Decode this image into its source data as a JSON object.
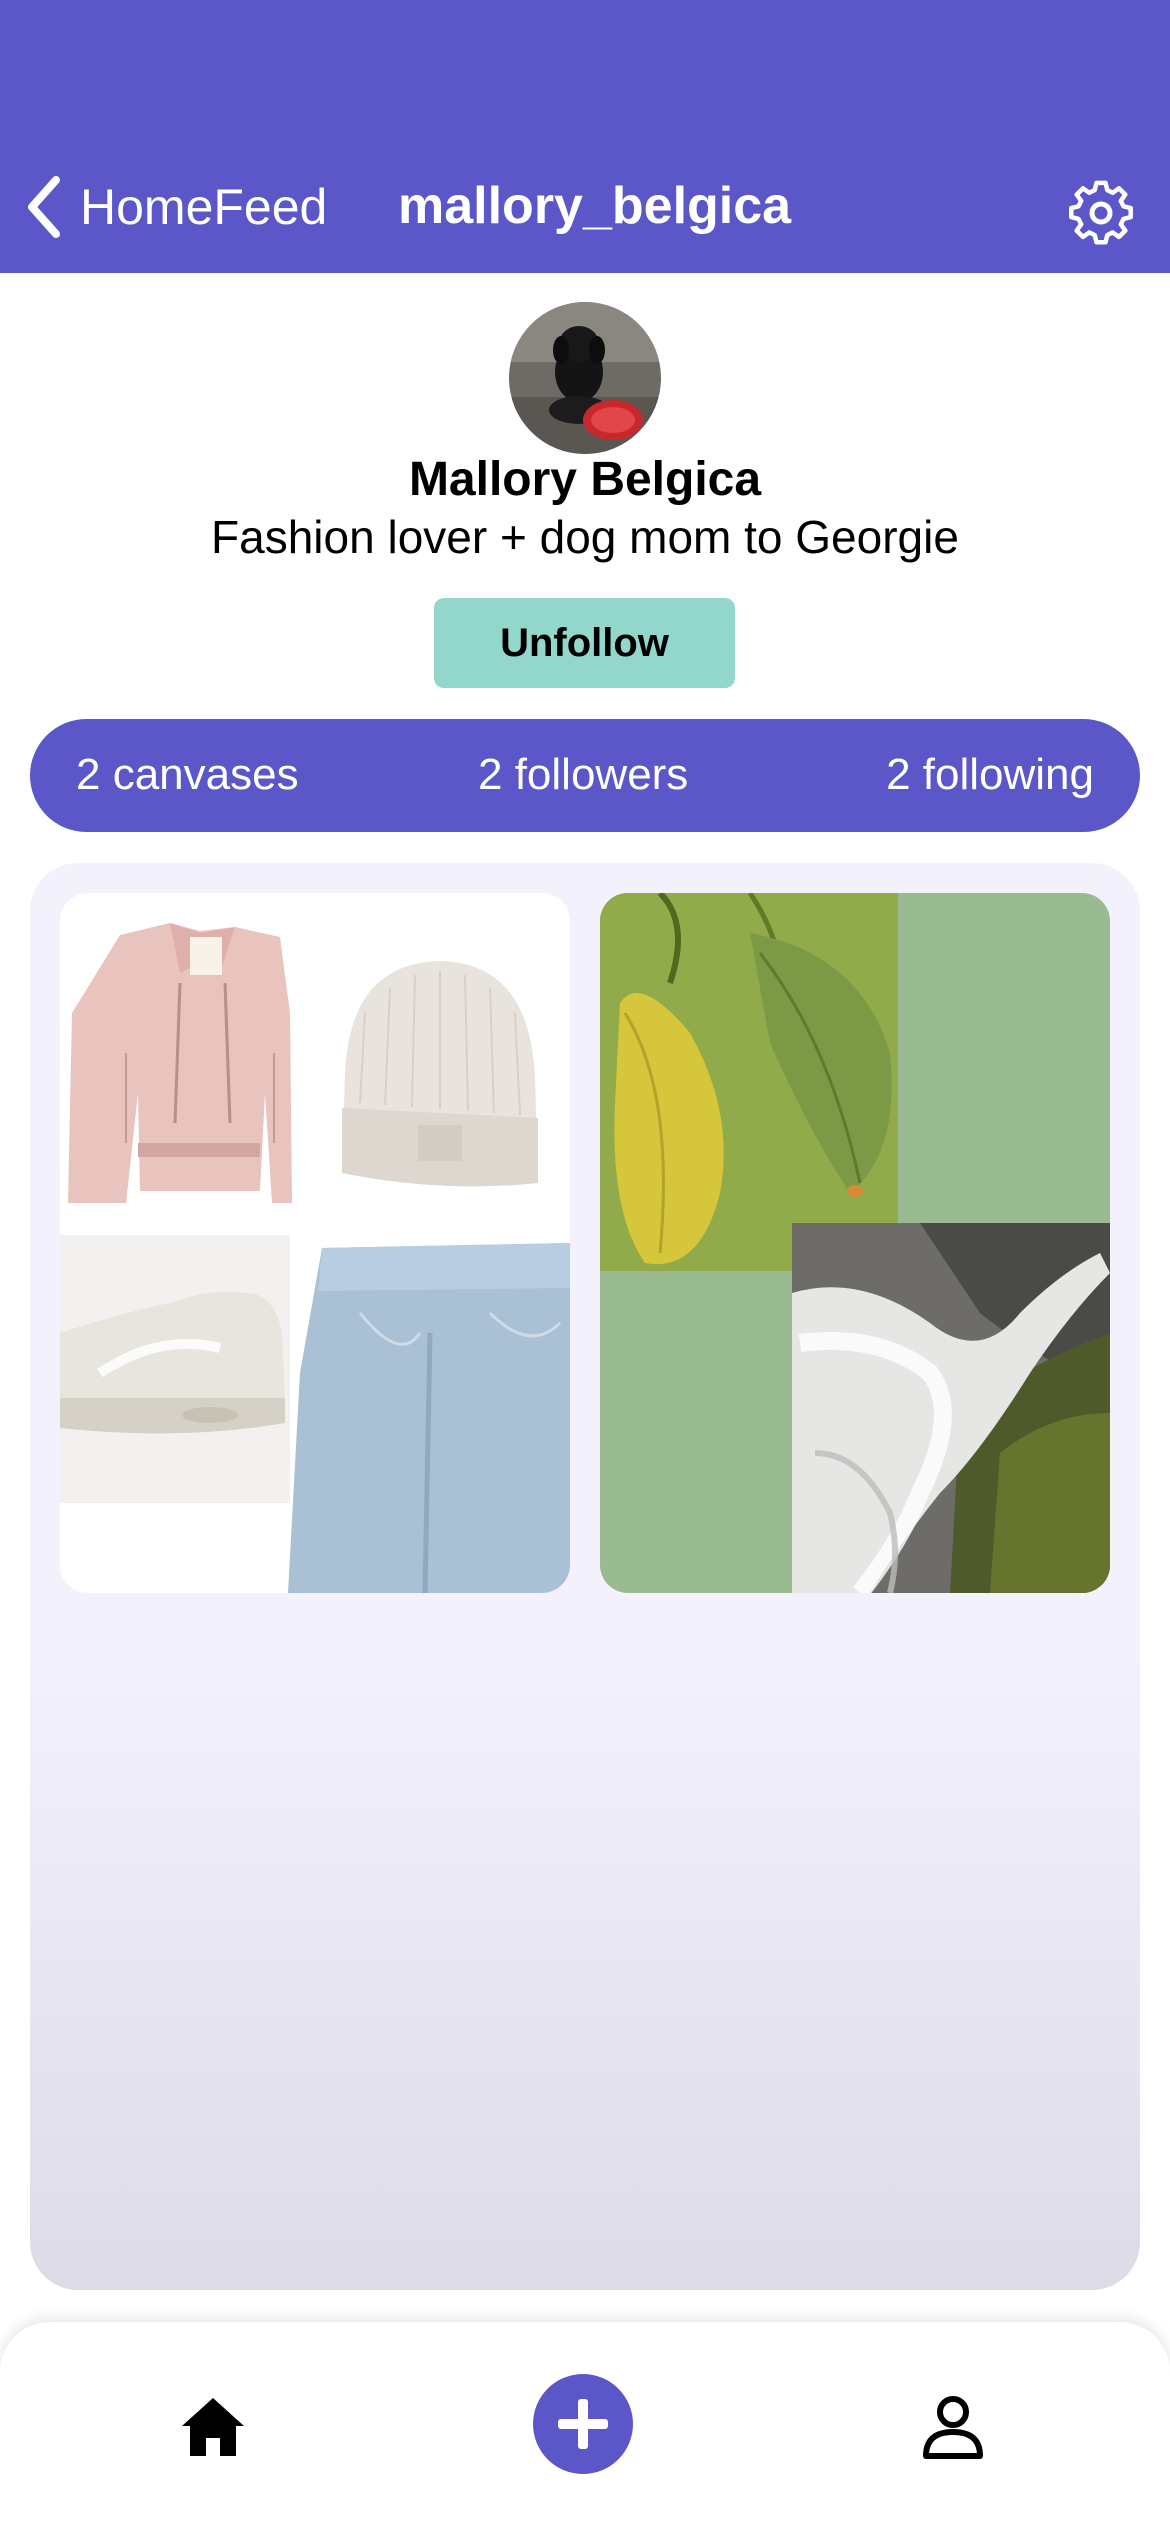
{
  "header": {
    "back_label": "HomeFeed",
    "username": "mallory_belgica",
    "background_color": "#5b57c9"
  },
  "profile": {
    "display_name": "Mallory Belgica",
    "bio": "Fashion lover + dog mom to Georgie",
    "follow_button_label": "Unfollow",
    "follow_button_color": "#93d7cc"
  },
  "stats": {
    "canvases": "2 canvases",
    "followers": "2 followers",
    "following": "2 following"
  },
  "canvases": [
    {
      "items": [
        "pink-leather-jacket",
        "cream-beanie",
        "white-sneaker",
        "light-wash-jeans"
      ]
    },
    {
      "items": [
        "lemon-leaf-photo",
        "waterfall-photo"
      ],
      "background_color": "#9aba91"
    }
  ],
  "tabbar": {
    "icons": [
      "home-icon",
      "add-icon",
      "profile-icon"
    ]
  }
}
